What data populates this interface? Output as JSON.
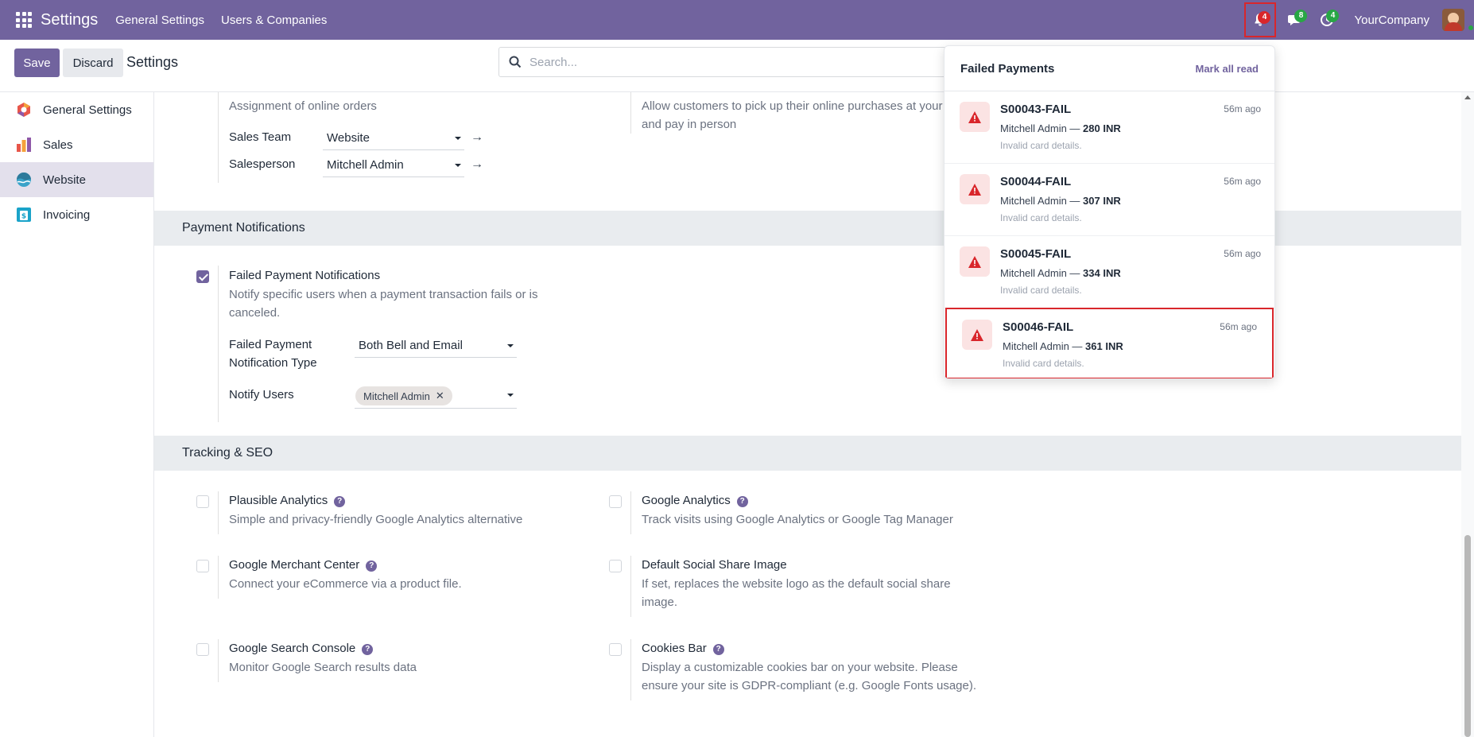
{
  "navbar": {
    "app_title": "Settings",
    "menu": [
      "General Settings",
      "Users & Companies"
    ],
    "notification_count": "4",
    "message_count": "8",
    "activity_count": "4",
    "company": "YourCompany"
  },
  "control_panel": {
    "save_label": "Save",
    "discard_label": "Discard",
    "title": "Settings",
    "search_placeholder": "Search..."
  },
  "sidebar": {
    "items": [
      {
        "label": "General Settings",
        "icon": "general-settings-icon"
      },
      {
        "label": "Sales",
        "icon": "sales-icon"
      },
      {
        "label": "Website",
        "icon": "website-icon",
        "active": true
      },
      {
        "label": "Invoicing",
        "icon": "invoicing-icon"
      }
    ]
  },
  "order_assignment": {
    "description": "Assignment of online orders",
    "sales_team_label": "Sales Team",
    "sales_team_value": "Website",
    "salesperson_label": "Salesperson",
    "salesperson_value": "Mitchell Admin"
  },
  "pickup": {
    "description_line1": "Allow customers to pick up their online purchases at your",
    "description_line2": "and pay in person"
  },
  "payment_notifications": {
    "section_title": "Payment Notifications",
    "setting_title": "Failed Payment Notifications",
    "setting_desc_line1": "Notify specific users when a payment transaction fails or is",
    "setting_desc_line2": "canceled.",
    "type_label_line1": "Failed Payment",
    "type_label_line2": "Notification Type",
    "type_value": "Both Bell and Email",
    "notify_users_label": "Notify Users",
    "notify_users_tag": "Mitchell Admin"
  },
  "tracking_seo": {
    "section_title": "Tracking & SEO",
    "settings": [
      {
        "title": "Plausible Analytics",
        "desc": [
          "Simple and privacy-friendly Google Analytics alternative"
        ]
      },
      {
        "title": "Google Analytics",
        "desc": [
          "Track visits using Google Analytics or Google Tag Manager"
        ]
      },
      {
        "title": "Google Merchant Center",
        "desc": [
          "Connect your eCommerce via a product file."
        ]
      },
      {
        "title": "Default Social Share Image",
        "desc": [
          "If set, replaces the website logo as the default social share",
          "image."
        ]
      },
      {
        "title": "Google Search Console",
        "desc": [
          "Monitor Google Search results data"
        ]
      },
      {
        "title": "Cookies Bar",
        "desc": [
          "Display a customizable cookies bar on your website. Please",
          "ensure your site is GDPR-compliant (e.g. Google Fonts usage)."
        ]
      }
    ]
  },
  "dropdown": {
    "title": "Failed Payments",
    "mark_all_read": "Mark all read",
    "notifications": [
      {
        "ref": "S00043-FAIL",
        "time": "56m ago",
        "user": "Mitchell Admin",
        "amount": "280 INR",
        "detail": "Invalid card details."
      },
      {
        "ref": "S00044-FAIL",
        "time": "56m ago",
        "user": "Mitchell Admin",
        "amount": "307 INR",
        "detail": "Invalid card details."
      },
      {
        "ref": "S00045-FAIL",
        "time": "56m ago",
        "user": "Mitchell Admin",
        "amount": "334 INR",
        "detail": "Invalid card details."
      },
      {
        "ref": "S00046-FAIL",
        "time": "56m ago",
        "user": "Mitchell Admin",
        "amount": "361 INR",
        "detail": "Invalid card details."
      }
    ]
  },
  "colors": {
    "brand": "#71639e",
    "alert": "#d9262b",
    "badge_green": "#28a745"
  }
}
